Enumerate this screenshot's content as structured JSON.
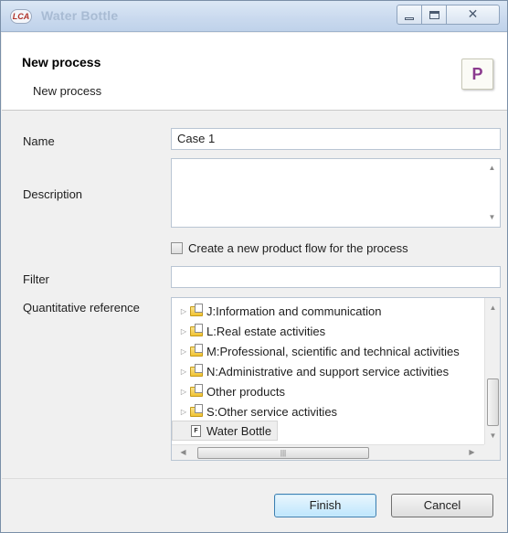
{
  "window": {
    "app_icon": "LCA",
    "title": "Water Bottle"
  },
  "header": {
    "title": "New process",
    "subtitle": "New process",
    "icon_letter": "P"
  },
  "form": {
    "name_label": "Name",
    "name_value": "Case 1",
    "description_label": "Description",
    "description_value": "",
    "checkbox_label": "Create a new product flow for the process",
    "checkbox_checked": false,
    "filter_label": "Filter",
    "filter_value": "",
    "quantitative_reference_label": "Quantitative reference"
  },
  "tree": {
    "items": [
      {
        "label": "J:Information and communication",
        "type": "folder"
      },
      {
        "label": "L:Real estate activities",
        "type": "folder"
      },
      {
        "label": "M:Professional, scientific and technical activities",
        "type": "folder"
      },
      {
        "label": "N:Administrative and support service activities",
        "type": "folder"
      },
      {
        "label": "Other products",
        "type": "folder"
      },
      {
        "label": "S:Other service activities",
        "type": "folder"
      },
      {
        "label": "Water Bottle",
        "type": "flow",
        "selected": true
      }
    ],
    "flow_icon_letter": "F"
  },
  "buttons": {
    "finish": "Finish",
    "cancel": "Cancel"
  },
  "icons": {
    "minimize": "minimize-icon",
    "maximize": "maximize-icon",
    "close": "close-icon",
    "folder": "folder-icon",
    "flow": "product-flow-icon",
    "expand": "expand-triangle-icon"
  },
  "colors": {
    "titlebar": "#c9d9ee",
    "finish_button_border": "#3c7fb1",
    "header_background": "#ffffff"
  }
}
